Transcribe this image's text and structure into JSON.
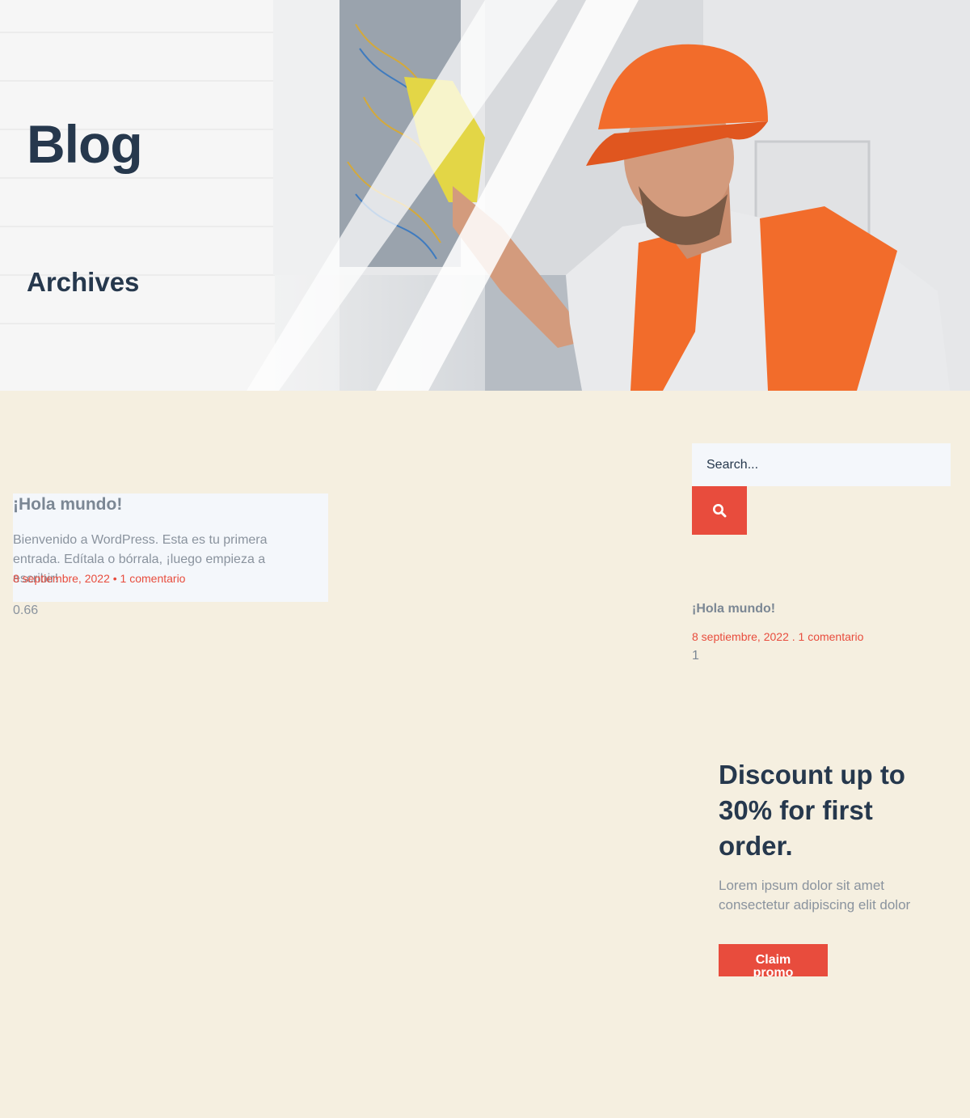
{
  "hero": {
    "title": "Blog",
    "subtitle": "Archives"
  },
  "post": {
    "title": "¡Hola mundo!",
    "excerpt": "Bienvenido a WordPress. Esta es tu primera entrada. Edítala o bórrala, ¡luego empieza a escribir!",
    "meta": "8 septiembre, 2022 • 1 comentario",
    "score": "0.66"
  },
  "sidebar": {
    "search": {
      "placeholder": "Search..."
    },
    "search_icon": "search-icon",
    "recent": {
      "title": "¡Hola mundo!",
      "meta": "8 septiembre, 2022 . 1 comentario",
      "count": "1"
    },
    "promo": {
      "heading": "Discount up to 30% for first order.",
      "text": "Lorem ipsum dolor sit amet consectetur adipiscing elit dolor",
      "button_label": "Claim promo"
    }
  },
  "colors": {
    "accent": "#e84c3d",
    "heading": "#26384d",
    "background": "#f5efe0",
    "card": "#f4f7fb",
    "vest": "#f26c2b"
  }
}
